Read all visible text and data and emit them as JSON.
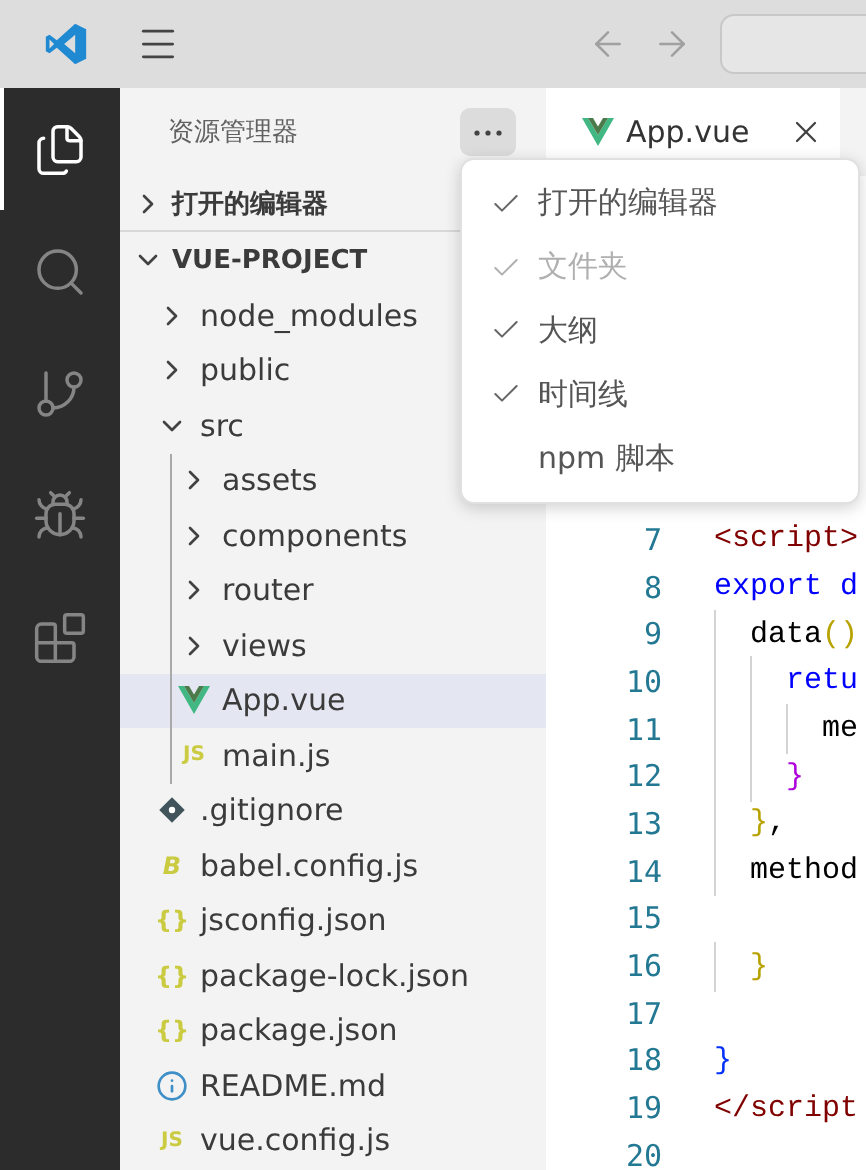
{
  "activity_bar": [
    {
      "kind": "explorer",
      "selected": true
    },
    {
      "kind": "search",
      "selected": false
    },
    {
      "kind": "source-control",
      "selected": false
    },
    {
      "kind": "run-debug",
      "selected": false
    },
    {
      "kind": "extensions",
      "selected": false
    }
  ],
  "sidebar": {
    "title": "资源管理器",
    "sections": [
      {
        "label": "打开的编辑器",
        "expanded": false
      },
      {
        "label": "VUE-PROJECT",
        "expanded": true,
        "tree": [
          {
            "name": "node_modules",
            "kind": "folder",
            "expanded": false,
            "selected": false
          },
          {
            "name": "public",
            "kind": "folder",
            "expanded": false,
            "selected": false
          },
          {
            "name": "src",
            "kind": "folder",
            "expanded": true,
            "selected": false,
            "children": [
              {
                "name": "assets",
                "kind": "folder",
                "expanded": false,
                "selected": false
              },
              {
                "name": "components",
                "kind": "folder",
                "expanded": false,
                "selected": false
              },
              {
                "name": "router",
                "kind": "folder",
                "expanded": false,
                "selected": false
              },
              {
                "name": "views",
                "kind": "folder",
                "expanded": false,
                "selected": false
              },
              {
                "name": "App.vue",
                "kind": "vue",
                "selected": true
              },
              {
                "name": "main.js",
                "kind": "js",
                "badge": "JS",
                "selected": false
              }
            ]
          },
          {
            "name": ".gitignore",
            "kind": "git",
            "selected": false
          },
          {
            "name": "babel.config.js",
            "kind": "babel",
            "badge": "B",
            "selected": false
          },
          {
            "name": "jsconfig.json",
            "kind": "json",
            "badge": "{}",
            "selected": false
          },
          {
            "name": "package-lock.json",
            "kind": "json",
            "badge": "{}",
            "selected": false
          },
          {
            "name": "package.json",
            "kind": "json",
            "badge": "{}",
            "selected": false
          },
          {
            "name": "README.md",
            "kind": "info",
            "selected": false
          },
          {
            "name": "vue.config.js",
            "kind": "js",
            "badge": "JS",
            "selected": false
          }
        ]
      }
    ]
  },
  "tabs": [
    {
      "label": "App.vue",
      "selected": true
    }
  ],
  "editor": {
    "lines": [
      {
        "number": "7",
        "tokens": [
          {
            "text": "<script>",
            "kind": "tag"
          }
        ]
      },
      {
        "number": "8",
        "tokens": [
          {
            "text": "export d",
            "kind": "keyword"
          }
        ]
      },
      {
        "number": "9",
        "tokens": [
          {
            "text": "  data",
            "kind": "plain"
          },
          {
            "text": "()",
            "kind": "bracket-gold"
          }
        ]
      },
      {
        "number": "10",
        "tokens": [
          {
            "text": "    retu",
            "kind": "keyword"
          }
        ]
      },
      {
        "number": "11",
        "tokens": [
          {
            "text": "      me",
            "kind": "plain"
          }
        ]
      },
      {
        "number": "12",
        "tokens": [
          {
            "text": "    }",
            "kind": "bracket-purple"
          }
        ]
      },
      {
        "number": "13",
        "tokens": [
          {
            "text": "  }",
            "kind": "bracket-gold"
          },
          {
            "text": ",",
            "kind": "plain"
          }
        ]
      },
      {
        "number": "14",
        "tokens": [
          {
            "text": "  method",
            "kind": "plain"
          }
        ]
      },
      {
        "number": "15"
      },
      {
        "number": "16",
        "tokens": [
          {
            "text": "  }",
            "kind": "bracket-gold"
          }
        ]
      },
      {
        "number": "17"
      },
      {
        "number": "18",
        "tokens": [
          {
            "text": "}",
            "kind": "bracket-blue"
          }
        ]
      },
      {
        "number": "19",
        "tokens": [
          {
            "text": "</script",
            "kind": "tag"
          }
        ]
      },
      {
        "number": "20"
      }
    ]
  },
  "menu": {
    "items": [
      {
        "label": "打开的编辑器",
        "checked": true,
        "disabled": false
      },
      {
        "label": "文件夹",
        "checked": true,
        "disabled": true
      },
      {
        "label": "大纲",
        "checked": true,
        "disabled": false
      },
      {
        "label": "时间线",
        "checked": true,
        "disabled": false
      },
      {
        "label": "npm 脚本",
        "checked": false,
        "disabled": false
      }
    ]
  }
}
